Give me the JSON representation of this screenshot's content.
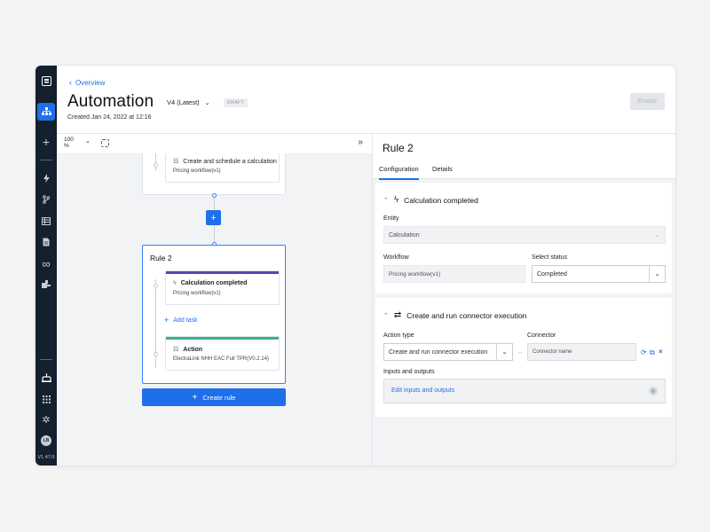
{
  "rail": {
    "icons": [
      "app-logo-icon",
      "workflow-icon",
      "plus-icon",
      "bolt-icon",
      "branch-icon",
      "table-icon",
      "document-icon",
      "infinity-icon",
      "connector-icon",
      "robot-icon",
      "grid-icon",
      "gear-icon"
    ],
    "avatar": "LB",
    "version": "V1.47.0"
  },
  "header": {
    "breadcrumb": "Overview",
    "title": "Automation",
    "version": "V4 (Latest)",
    "status": "DRAFT",
    "created": "Created Jan 24, 2022 at 12:16",
    "enable_label": "Enable"
  },
  "canvas": {
    "zoom_value": "100",
    "zoom_unit": "%",
    "rule1": {
      "task_title": "Create and schedule a calculation",
      "task_sub": "Pricing workflow(v1)"
    },
    "rule2": {
      "title": "Rule 2",
      "trigger_title": "Calculation completed",
      "trigger_sub": "Pricing workflow(v1)",
      "add_task": "Add task",
      "action_title": "Action",
      "action_sub": "ElectraLink NHH EAC Full TPR(V0.2.14)"
    },
    "create_rule": "Create rule",
    "colors": {
      "trigger_bar": "#5b45b0",
      "action_bar": "#3bb08f",
      "accent": "#1f6feb"
    }
  },
  "panel": {
    "title": "Rule 2",
    "tabs": [
      "Configuration",
      "Details"
    ],
    "trigger": {
      "heading": "Calculation completed",
      "entity_label": "Entity",
      "entity_value": "Calculation",
      "workflow_label": "Workflow",
      "workflow_value": "Pricing workflow(v1)",
      "status_label": "Select status",
      "status_value": "Completed"
    },
    "action": {
      "heading": "Create and run connector execution",
      "type_label": "Action type",
      "type_value": "Create and run connector execution",
      "connector_label": "Connector",
      "connector_placeholder": "Connector name",
      "io_label": "Inputs and outputs",
      "io_link": "Edit inputs and outputs"
    }
  }
}
